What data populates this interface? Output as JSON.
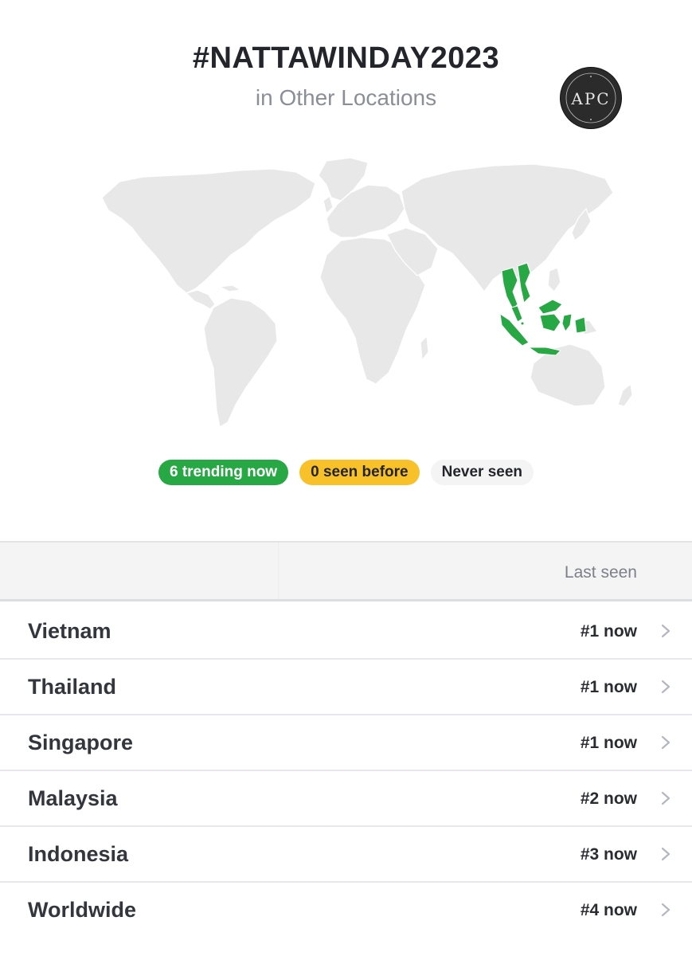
{
  "header": {
    "title": "#NATTAWINDAY2023",
    "subtitle": "in Other Locations"
  },
  "watermark": {
    "text": "APC"
  },
  "legend": {
    "trending": "6 trending now",
    "seen_before": "0 seen before",
    "never_seen": "Never seen"
  },
  "table": {
    "column_header": "Last seen",
    "rows": [
      {
        "location": "Vietnam",
        "rank": "#1 now"
      },
      {
        "location": "Thailand",
        "rank": "#1 now"
      },
      {
        "location": "Singapore",
        "rank": "#1 now"
      },
      {
        "location": "Malaysia",
        "rank": "#2 now"
      },
      {
        "location": "Indonesia",
        "rank": "#3 now"
      },
      {
        "location": "Worldwide",
        "rank": "#4 now"
      }
    ]
  },
  "colors": {
    "trending": "#27a844",
    "seen_before": "#f8c12a",
    "never_seen": "#f4f4f5",
    "land": "#e8e8e9"
  }
}
